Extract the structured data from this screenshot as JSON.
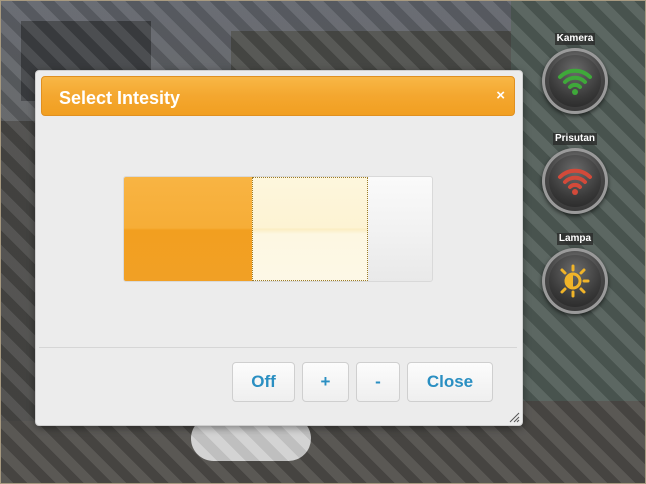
{
  "dialog": {
    "title": "Select Intesity",
    "close_glyph": "×",
    "intensity": {
      "levels_total": 3,
      "selected_level": 1,
      "hovered_level": 2
    },
    "buttons": {
      "off": "Off",
      "plus": "+",
      "minus": "-",
      "close": "Close"
    }
  },
  "controls": [
    {
      "label": "Kamera",
      "icon": "wifi-icon",
      "color": "#3fa83a"
    },
    {
      "label": "Prisutan",
      "icon": "wifi-icon",
      "color": "#d24a3a"
    },
    {
      "label": "Lampa",
      "icon": "lightbulb-sun-icon",
      "color": "#f0b429"
    }
  ],
  "colors": {
    "accent": "#f4a72f",
    "button_text": "#2a8fc2"
  }
}
